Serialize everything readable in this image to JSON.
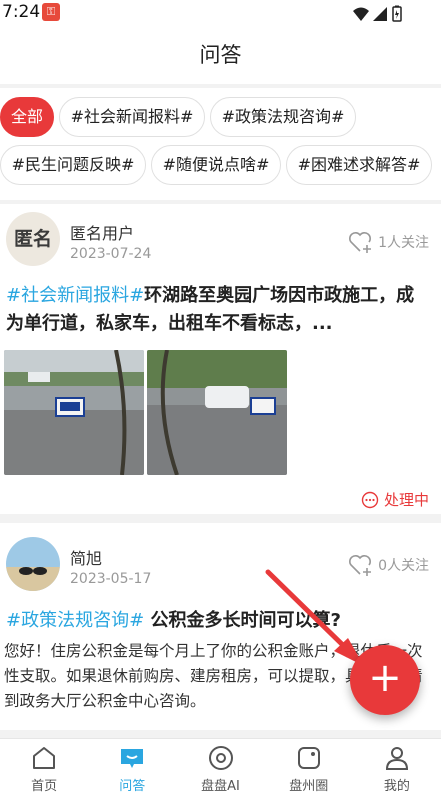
{
  "status_bar": {
    "time": "7:24"
  },
  "header": {
    "title": "问答"
  },
  "tags": [
    {
      "label": "全部",
      "active": true
    },
    {
      "label": "#社会新闻报料#"
    },
    {
      "label": "#政策法规咨询#"
    },
    {
      "label": "#民生问题反映#"
    },
    {
      "label": "#随便说点啥#"
    },
    {
      "label": "#困难述求解答#"
    }
  ],
  "posts": [
    {
      "avatar_text": "匿名",
      "username": "匿名用户",
      "date": "2023-07-24",
      "followers": "1人关注",
      "topic": "#社会新闻报料#",
      "title": "环湖路至奥园广场因市政施工，成为单行道，私家车，出租车不看标志，...",
      "status": "处理中"
    },
    {
      "username": "简旭",
      "date": "2023-05-17",
      "followers": "0人关注",
      "topic": "#政策法规咨询#",
      "title": "公积金多长时间可以算?",
      "body": "您好！住房公积金是每个月上了你的公积金账户，退休后一次性支取。如果退休前购房、建房租房，可以提取，具体手续请到政务大厅公积金中心咨询。"
    }
  ],
  "fab": {
    "label": "+"
  },
  "bottom_nav": [
    {
      "label": "首页",
      "icon": "home-icon"
    },
    {
      "label": "问答",
      "icon": "chat-icon",
      "active": true
    },
    {
      "label": "盘盘AI",
      "icon": "ai-icon"
    },
    {
      "label": "盘州圈",
      "icon": "circle-icon"
    },
    {
      "label": "我的",
      "icon": "user-icon"
    }
  ],
  "colors": {
    "accent": "#e8393a",
    "topic": "#2aa6e0"
  }
}
